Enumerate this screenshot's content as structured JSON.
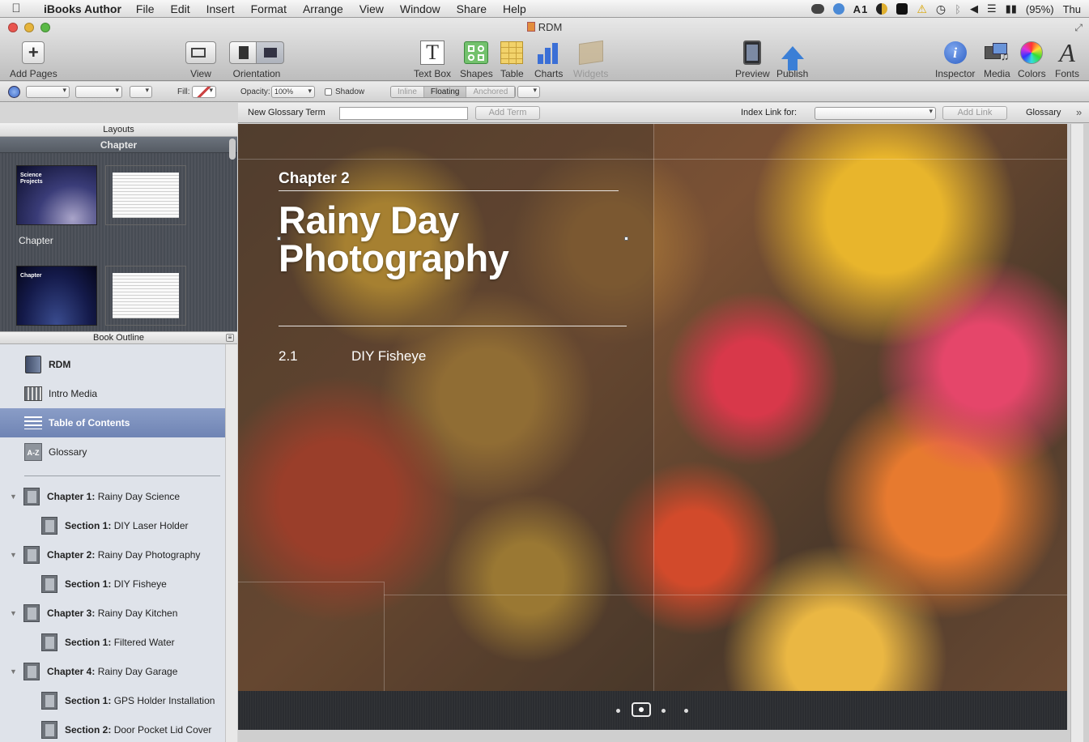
{
  "menubar": {
    "app_name": "iBooks Author",
    "menus": [
      "File",
      "Edit",
      "Insert",
      "Format",
      "Arrange",
      "View",
      "Window",
      "Share",
      "Help"
    ],
    "status": {
      "adobe_count": "1",
      "battery": "(95%)",
      "clock": "Thu"
    }
  },
  "window": {
    "title": "RDM"
  },
  "toolbar": {
    "add_pages": "Add Pages",
    "view": "View",
    "orientation": "Orientation",
    "text_box": "Text Box",
    "shapes": "Shapes",
    "table": "Table",
    "charts": "Charts",
    "widgets": "Widgets",
    "preview": "Preview",
    "publish": "Publish",
    "inspector": "Inspector",
    "media": "Media",
    "colors": "Colors",
    "fonts": "Fonts"
  },
  "formatbar": {
    "fill_label": "Fill:",
    "opacity_label": "Opacity:",
    "opacity_value": "100%",
    "shadow_label": "Shadow",
    "wrap_modes": [
      "Inline",
      "Floating",
      "Anchored"
    ]
  },
  "glossary_bar": {
    "new_term_label": "New Glossary Term",
    "add_term": "Add Term",
    "index_link_label": "Index Link for:",
    "add_link": "Add Link",
    "glossary": "Glossary"
  },
  "layouts": {
    "header": "Layouts",
    "category": "Chapter",
    "thumb_1_text": "Science Projects",
    "caption_1": "Chapter",
    "thumb_2_text": "Chapter"
  },
  "outline": {
    "header": "Book Outline",
    "top_items": [
      {
        "label": "RDM"
      },
      {
        "label": "Intro Media"
      },
      {
        "label": "Table of Contents"
      },
      {
        "label": "Glossary"
      }
    ],
    "glossary_icon_text": "A-Z",
    "chapters": [
      {
        "prefix": "Chapter 1:",
        "title": "Rainy Day Science",
        "section_prefix": "Section 1:",
        "section": "DIY Laser Holder"
      },
      {
        "prefix": "Chapter 2:",
        "title": "Rainy Day Photography",
        "section_prefix": "Section 1:",
        "section": "DIY Fisheye"
      },
      {
        "prefix": "Chapter 3:",
        "title": "Rainy Day Kitchen",
        "section_prefix": "Section 1:",
        "section": "Filtered Water"
      },
      {
        "prefix": "Chapter 4:",
        "title": "Rainy Day Garage",
        "section_prefix": "Section 1:",
        "section": "GPS Holder Installation"
      }
    ],
    "extra_section": {
      "prefix": "Section 2:",
      "title": "Door Pocket Lid Cover"
    }
  },
  "page": {
    "chapter_label": "Chapter 2",
    "title": "Rainy Day Photography",
    "toc_number": "2.1",
    "toc_title": "DIY Fisheye"
  },
  "colors": {
    "selection": "#7487b6",
    "publish_blue": "#3b7fd6",
    "inspector_blue": "#3a6fd0"
  }
}
